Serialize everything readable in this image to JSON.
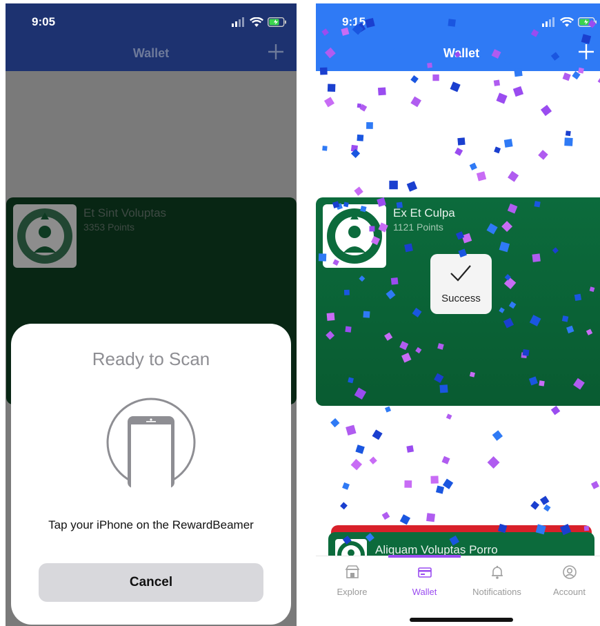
{
  "left": {
    "status_time": "9:05",
    "nav_title": "Wallet",
    "card": {
      "title": "Et Sint Voluptas",
      "points": "3353 Points"
    },
    "sheet": {
      "title": "Ready to Scan",
      "message": "Tap your iPhone on the RewardBeamer",
      "cancel_label": "Cancel"
    }
  },
  "right": {
    "status_time": "9:15",
    "nav_title": "Wallet",
    "card": {
      "title": "Ex Et Culpa",
      "points": "1121 Points"
    },
    "toast_label": "Success",
    "second_card_title": "Aliquam Voluptas Porro",
    "tabs": [
      {
        "label": "Explore",
        "icon": "store-icon",
        "active": false
      },
      {
        "label": "Wallet",
        "icon": "wallet-icon",
        "active": true
      },
      {
        "label": "Notifications",
        "icon": "bell-icon",
        "active": false
      },
      {
        "label": "Account",
        "icon": "account-icon",
        "active": false
      }
    ]
  },
  "colors": {
    "header_dimmed": "#1d3270",
    "header_blue": "#2f7af5",
    "card_green": "#0c6b3c",
    "card_red": "#d8202a",
    "accent_purple": "#9a4cf0",
    "confetti_blue": "#1a56e0",
    "confetti_purple": "#b05cf0"
  }
}
